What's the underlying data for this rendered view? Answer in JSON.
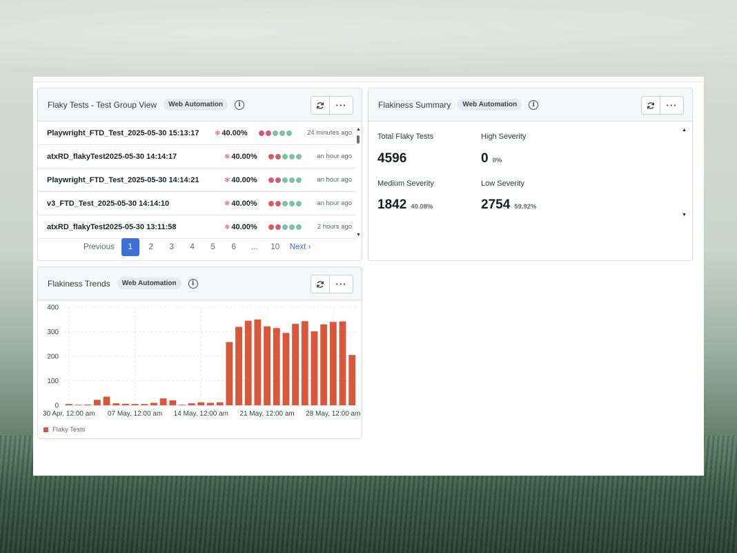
{
  "colors": {
    "accent": "#3c6fd6",
    "bar": "#d9573b",
    "dot_red": "#d35d6e",
    "dot_green": "#7cc3a6",
    "snow": "#d0505a"
  },
  "flaky_tests": {
    "title": "Flaky Tests - Test Group View",
    "badge": "Web Automation",
    "refresh_icon": "refresh-icon",
    "more_icon": "more-icon",
    "rows": [
      {
        "name": "Playwright_FTD_Test_2025-05-30 15:13:17",
        "pct": "40.00%",
        "ago": "24 minutes ago",
        "dots": [
          "red",
          "red",
          "green",
          "green",
          "green"
        ]
      },
      {
        "name": "atxRD_flakyTest2025-05-30 14:14:17",
        "pct": "40.00%",
        "ago": "an hour ago",
        "dots": [
          "red",
          "red",
          "green",
          "green",
          "green"
        ]
      },
      {
        "name": "Playwright_FTD_Test_2025-05-30 14:14:21",
        "pct": "40.00%",
        "ago": "an hour ago",
        "dots": [
          "red",
          "red",
          "green",
          "green",
          "green"
        ]
      },
      {
        "name": "v3_FTD_Test_2025-05-30 14:14:10",
        "pct": "40.00%",
        "ago": "an hour ago",
        "dots": [
          "red",
          "red",
          "green",
          "green",
          "green"
        ]
      },
      {
        "name": "atxRD_flakyTest2025-05-30 13:11:58",
        "pct": "40.00%",
        "ago": "2 hours ago",
        "dots": [
          "red",
          "red",
          "green",
          "green",
          "green"
        ]
      }
    ],
    "pagination": {
      "previous": "Previous",
      "pages": [
        "1",
        "2",
        "3",
        "4",
        "5",
        "6",
        "...",
        "10"
      ],
      "current": "1",
      "next": "Next"
    }
  },
  "summary": {
    "title": "Flakiness Summary",
    "badge": "Web Automation",
    "total_label": "Total Flaky Tests",
    "total_value": "4596",
    "high_label": "High Severity",
    "high_value": "0",
    "high_pct": "0%",
    "medium_label": "Medium Severity",
    "medium_value": "1842",
    "medium_pct": "40.08%",
    "low_label": "Low Severity",
    "low_value": "2754",
    "low_pct": "59.92%"
  },
  "trends": {
    "title": "Flakiness Trends",
    "badge": "Web Automation",
    "legend": "Flaky Tests"
  },
  "chart_data": {
    "type": "bar",
    "title": "",
    "xlabel": "",
    "ylabel": "",
    "ylim": [
      0,
      400
    ],
    "yticks": [
      0,
      100,
      200,
      300,
      400
    ],
    "xtick_labels": [
      "30 Apr, 12:00 am",
      "07 May, 12:00 am",
      "14 May, 12:00 am",
      "21 May, 12:00 am",
      "28 May, 12:00 am"
    ],
    "xtick_indices": [
      0,
      7,
      14,
      21,
      28
    ],
    "grid": true,
    "legend_position": "bottom-left",
    "series": [
      {
        "name": "Flaky Tests",
        "values": [
          5,
          2,
          3,
          22,
          35,
          8,
          6,
          5,
          5,
          10,
          28,
          20,
          2,
          8,
          12,
          10,
          12,
          258,
          320,
          345,
          350,
          322,
          315,
          295,
          332,
          343,
          302,
          330,
          340,
          342,
          205
        ]
      }
    ]
  }
}
